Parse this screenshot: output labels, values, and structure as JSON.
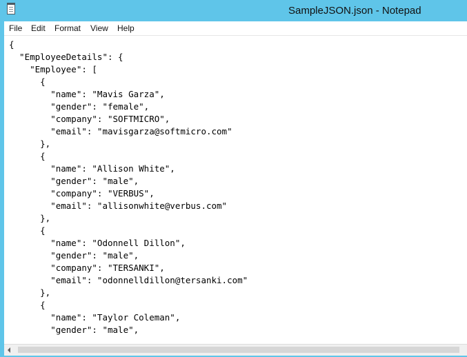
{
  "window": {
    "title": "SampleJSON.json - Notepad",
    "accent_color": "#5fc5e9",
    "app_icon": "notepad-icon"
  },
  "menu": {
    "items": [
      "File",
      "Edit",
      "Format",
      "View",
      "Help"
    ]
  },
  "editor": {
    "content": "{\n  \"EmployeeDetails\": {\n    \"Employee\": [\n      {\n        \"name\": \"Mavis Garza\",\n        \"gender\": \"female\",\n        \"company\": \"SOFTMICRO\",\n        \"email\": \"mavisgarza@softmicro.com\"\n      },\n      {\n        \"name\": \"Allison White\",\n        \"gender\": \"male\",\n        \"company\": \"VERBUS\",\n        \"email\": \"allisonwhite@verbus.com\"\n      },\n      {\n        \"name\": \"Odonnell Dillon\",\n        \"gender\": \"male\",\n        \"company\": \"TERSANKI\",\n        \"email\": \"odonnelldillon@tersanki.com\"\n      },\n      {\n        \"name\": \"Taylor Coleman\",\n        \"gender\": \"male\","
  },
  "scrollbar": {
    "left_arrow": "chevron-left-icon"
  }
}
